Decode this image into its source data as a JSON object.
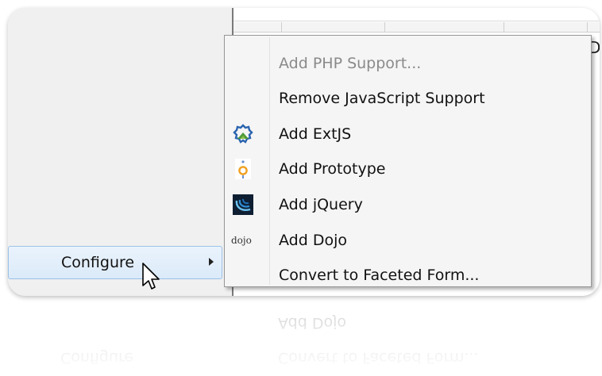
{
  "context_menu": {
    "configure_label": "Configure"
  },
  "submenu": {
    "items": [
      {
        "label": "Add PHP Support...",
        "enabled": false,
        "icon": ""
      },
      {
        "label": "Remove JavaScript Support",
        "enabled": true,
        "icon": ""
      },
      {
        "label": "Add ExtJS",
        "enabled": true,
        "icon": "extjs-icon"
      },
      {
        "label": "Add Prototype",
        "enabled": true,
        "icon": "prototype-icon"
      },
      {
        "label": "Add jQuery",
        "enabled": true,
        "icon": "jquery-icon"
      },
      {
        "label": "Add Dojo",
        "enabled": true,
        "icon": "dojo-icon",
        "icon_text": "dojo"
      },
      {
        "label": "Convert to Faceted Form...",
        "enabled": true,
        "icon": ""
      }
    ]
  },
  "background_editor": {
    "edge_text": "D"
  },
  "colors": {
    "menu_bg": "#f5f5f5",
    "hover_bg": "#dbeaf9",
    "hover_border": "#9cc1e8",
    "disabled_text": "#8a8a8a"
  }
}
